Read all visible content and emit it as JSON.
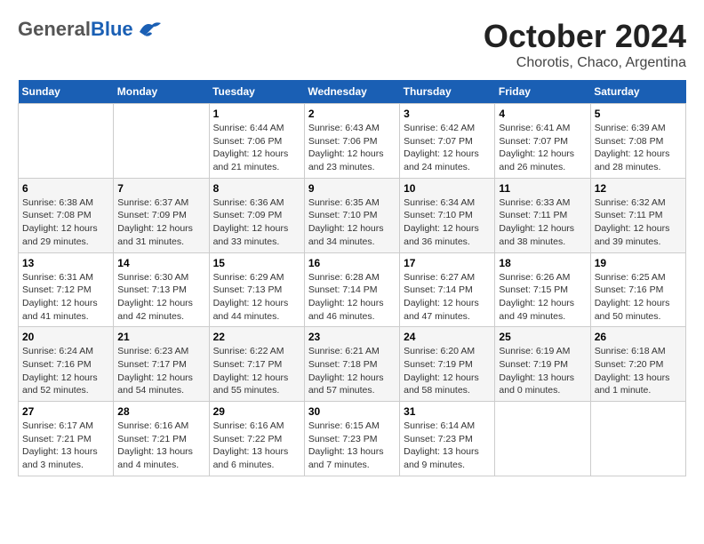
{
  "header": {
    "logo_general": "General",
    "logo_blue": "Blue",
    "month": "October 2024",
    "location": "Chorotis, Chaco, Argentina"
  },
  "weekdays": [
    "Sunday",
    "Monday",
    "Tuesday",
    "Wednesday",
    "Thursday",
    "Friday",
    "Saturday"
  ],
  "weeks": [
    [
      {
        "day": "",
        "content": ""
      },
      {
        "day": "",
        "content": ""
      },
      {
        "day": "1",
        "sunrise": "Sunrise: 6:44 AM",
        "sunset": "Sunset: 7:06 PM",
        "daylight": "Daylight: 12 hours and 21 minutes."
      },
      {
        "day": "2",
        "sunrise": "Sunrise: 6:43 AM",
        "sunset": "Sunset: 7:06 PM",
        "daylight": "Daylight: 12 hours and 23 minutes."
      },
      {
        "day": "3",
        "sunrise": "Sunrise: 6:42 AM",
        "sunset": "Sunset: 7:07 PM",
        "daylight": "Daylight: 12 hours and 24 minutes."
      },
      {
        "day": "4",
        "sunrise": "Sunrise: 6:41 AM",
        "sunset": "Sunset: 7:07 PM",
        "daylight": "Daylight: 12 hours and 26 minutes."
      },
      {
        "day": "5",
        "sunrise": "Sunrise: 6:39 AM",
        "sunset": "Sunset: 7:08 PM",
        "daylight": "Daylight: 12 hours and 28 minutes."
      }
    ],
    [
      {
        "day": "6",
        "sunrise": "Sunrise: 6:38 AM",
        "sunset": "Sunset: 7:08 PM",
        "daylight": "Daylight: 12 hours and 29 minutes."
      },
      {
        "day": "7",
        "sunrise": "Sunrise: 6:37 AM",
        "sunset": "Sunset: 7:09 PM",
        "daylight": "Daylight: 12 hours and 31 minutes."
      },
      {
        "day": "8",
        "sunrise": "Sunrise: 6:36 AM",
        "sunset": "Sunset: 7:09 PM",
        "daylight": "Daylight: 12 hours and 33 minutes."
      },
      {
        "day": "9",
        "sunrise": "Sunrise: 6:35 AM",
        "sunset": "Sunset: 7:10 PM",
        "daylight": "Daylight: 12 hours and 34 minutes."
      },
      {
        "day": "10",
        "sunrise": "Sunrise: 6:34 AM",
        "sunset": "Sunset: 7:10 PM",
        "daylight": "Daylight: 12 hours and 36 minutes."
      },
      {
        "day": "11",
        "sunrise": "Sunrise: 6:33 AM",
        "sunset": "Sunset: 7:11 PM",
        "daylight": "Daylight: 12 hours and 38 minutes."
      },
      {
        "day": "12",
        "sunrise": "Sunrise: 6:32 AM",
        "sunset": "Sunset: 7:11 PM",
        "daylight": "Daylight: 12 hours and 39 minutes."
      }
    ],
    [
      {
        "day": "13",
        "sunrise": "Sunrise: 6:31 AM",
        "sunset": "Sunset: 7:12 PM",
        "daylight": "Daylight: 12 hours and 41 minutes."
      },
      {
        "day": "14",
        "sunrise": "Sunrise: 6:30 AM",
        "sunset": "Sunset: 7:13 PM",
        "daylight": "Daylight: 12 hours and 42 minutes."
      },
      {
        "day": "15",
        "sunrise": "Sunrise: 6:29 AM",
        "sunset": "Sunset: 7:13 PM",
        "daylight": "Daylight: 12 hours and 44 minutes."
      },
      {
        "day": "16",
        "sunrise": "Sunrise: 6:28 AM",
        "sunset": "Sunset: 7:14 PM",
        "daylight": "Daylight: 12 hours and 46 minutes."
      },
      {
        "day": "17",
        "sunrise": "Sunrise: 6:27 AM",
        "sunset": "Sunset: 7:14 PM",
        "daylight": "Daylight: 12 hours and 47 minutes."
      },
      {
        "day": "18",
        "sunrise": "Sunrise: 6:26 AM",
        "sunset": "Sunset: 7:15 PM",
        "daylight": "Daylight: 12 hours and 49 minutes."
      },
      {
        "day": "19",
        "sunrise": "Sunrise: 6:25 AM",
        "sunset": "Sunset: 7:16 PM",
        "daylight": "Daylight: 12 hours and 50 minutes."
      }
    ],
    [
      {
        "day": "20",
        "sunrise": "Sunrise: 6:24 AM",
        "sunset": "Sunset: 7:16 PM",
        "daylight": "Daylight: 12 hours and 52 minutes."
      },
      {
        "day": "21",
        "sunrise": "Sunrise: 6:23 AM",
        "sunset": "Sunset: 7:17 PM",
        "daylight": "Daylight: 12 hours and 54 minutes."
      },
      {
        "day": "22",
        "sunrise": "Sunrise: 6:22 AM",
        "sunset": "Sunset: 7:17 PM",
        "daylight": "Daylight: 12 hours and 55 minutes."
      },
      {
        "day": "23",
        "sunrise": "Sunrise: 6:21 AM",
        "sunset": "Sunset: 7:18 PM",
        "daylight": "Daylight: 12 hours and 57 minutes."
      },
      {
        "day": "24",
        "sunrise": "Sunrise: 6:20 AM",
        "sunset": "Sunset: 7:19 PM",
        "daylight": "Daylight: 12 hours and 58 minutes."
      },
      {
        "day": "25",
        "sunrise": "Sunrise: 6:19 AM",
        "sunset": "Sunset: 7:19 PM",
        "daylight": "Daylight: 13 hours and 0 minutes."
      },
      {
        "day": "26",
        "sunrise": "Sunrise: 6:18 AM",
        "sunset": "Sunset: 7:20 PM",
        "daylight": "Daylight: 13 hours and 1 minute."
      }
    ],
    [
      {
        "day": "27",
        "sunrise": "Sunrise: 6:17 AM",
        "sunset": "Sunset: 7:21 PM",
        "daylight": "Daylight: 13 hours and 3 minutes."
      },
      {
        "day": "28",
        "sunrise": "Sunrise: 6:16 AM",
        "sunset": "Sunset: 7:21 PM",
        "daylight": "Daylight: 13 hours and 4 minutes."
      },
      {
        "day": "29",
        "sunrise": "Sunrise: 6:16 AM",
        "sunset": "Sunset: 7:22 PM",
        "daylight": "Daylight: 13 hours and 6 minutes."
      },
      {
        "day": "30",
        "sunrise": "Sunrise: 6:15 AM",
        "sunset": "Sunset: 7:23 PM",
        "daylight": "Daylight: 13 hours and 7 minutes."
      },
      {
        "day": "31",
        "sunrise": "Sunrise: 6:14 AM",
        "sunset": "Sunset: 7:23 PM",
        "daylight": "Daylight: 13 hours and 9 minutes."
      },
      {
        "day": "",
        "content": ""
      },
      {
        "day": "",
        "content": ""
      }
    ]
  ]
}
